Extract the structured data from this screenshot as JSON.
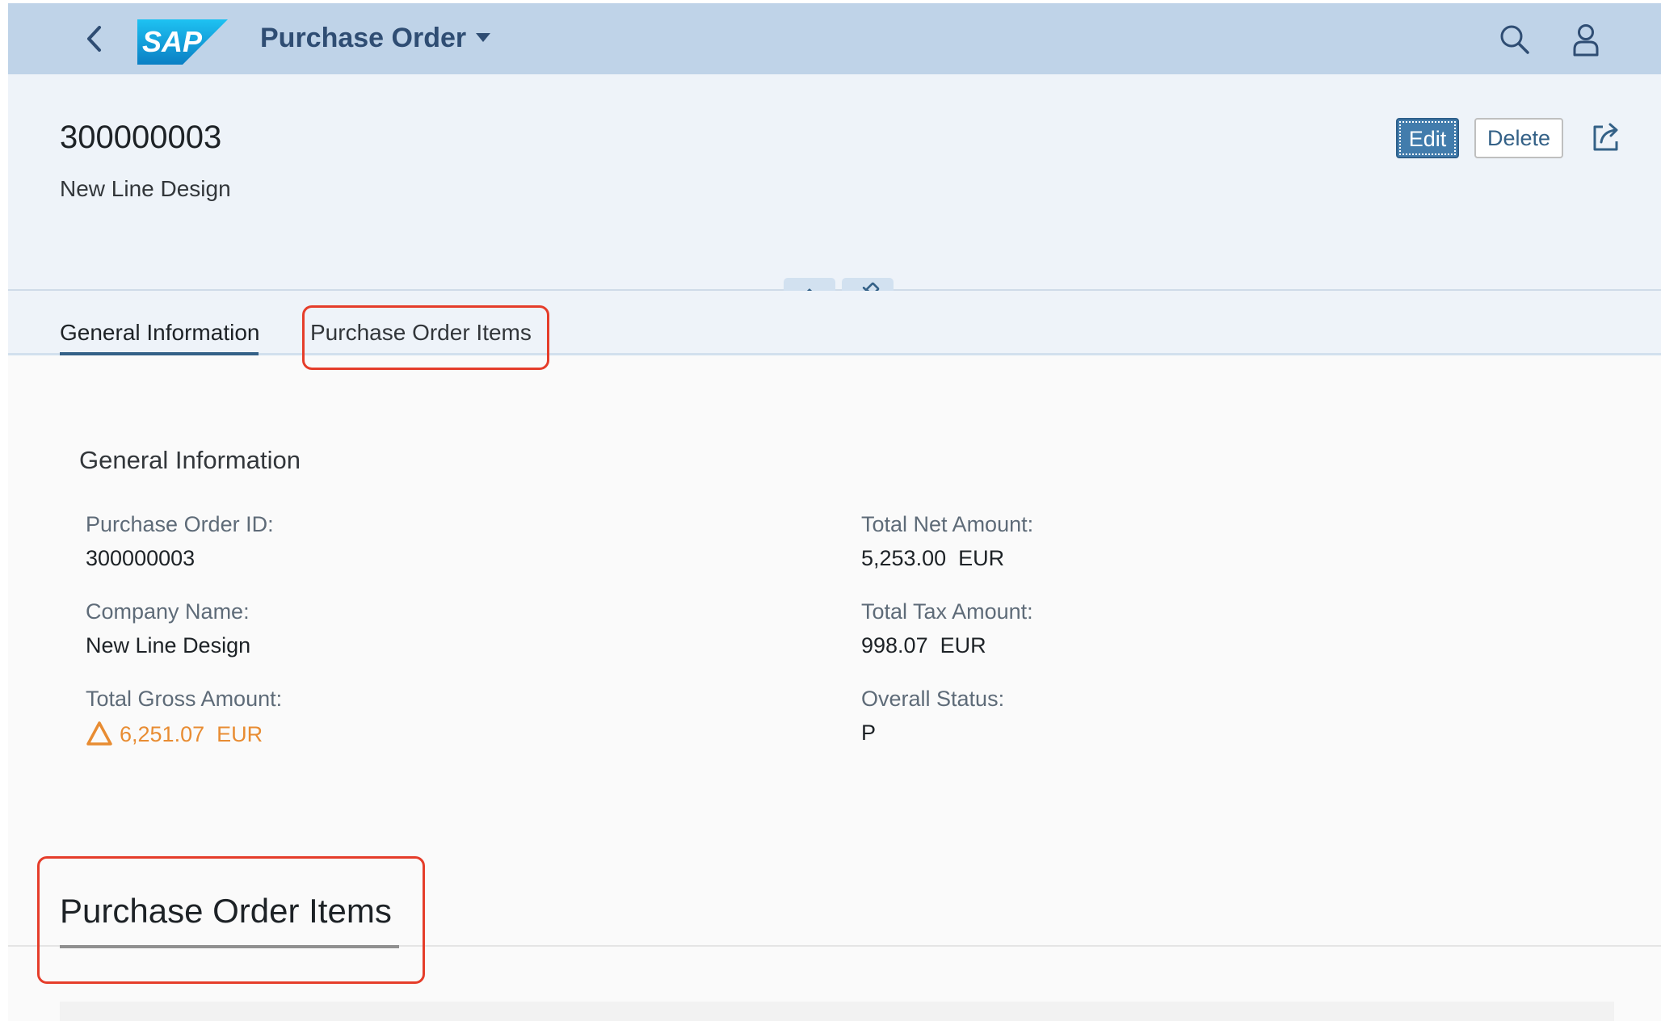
{
  "shell": {
    "app_title": "Purchase Order",
    "logo_text": "SAP",
    "icons": {
      "back": "chevron-left-icon",
      "search": "search-icon",
      "user": "user-icon",
      "dropdown": "caret-down-icon"
    }
  },
  "object": {
    "title": "300000003",
    "subtitle": "New Line Design",
    "actions": {
      "edit_label": "Edit",
      "delete_label": "Delete",
      "share_icon": "share-icon"
    },
    "header_controls": {
      "collapse_icon": "chevron-up-icon",
      "pin_icon": "pin-icon"
    }
  },
  "tabs": [
    {
      "label": "General Information",
      "selected": true
    },
    {
      "label": "Purchase Order Items",
      "selected": false
    }
  ],
  "general_information": {
    "title": "General Information",
    "fields": {
      "po_id": {
        "label": "Purchase Order ID:",
        "value": "300000003"
      },
      "company": {
        "label": "Company Name:",
        "value": "New Line Design"
      },
      "gross": {
        "label": "Total Gross Amount:",
        "value": "6,251.07",
        "currency": "EUR",
        "status": "warning"
      },
      "net": {
        "label": "Total Net Amount:",
        "value": "5,253.00",
        "currency": "EUR"
      },
      "tax": {
        "label": "Total Tax Amount:",
        "value": "998.07",
        "currency": "EUR"
      },
      "overall_status": {
        "label": "Overall Status:",
        "value": "P"
      }
    }
  },
  "items_section": {
    "title": "Purchase Order Items"
  },
  "colors": {
    "shell_bg": "#bfd3e8",
    "header_bg": "#eef3f9",
    "accent": "#346187",
    "emphasized_button": "#427cac",
    "warning": "#e88c32",
    "annotation": "#e53d2a"
  }
}
